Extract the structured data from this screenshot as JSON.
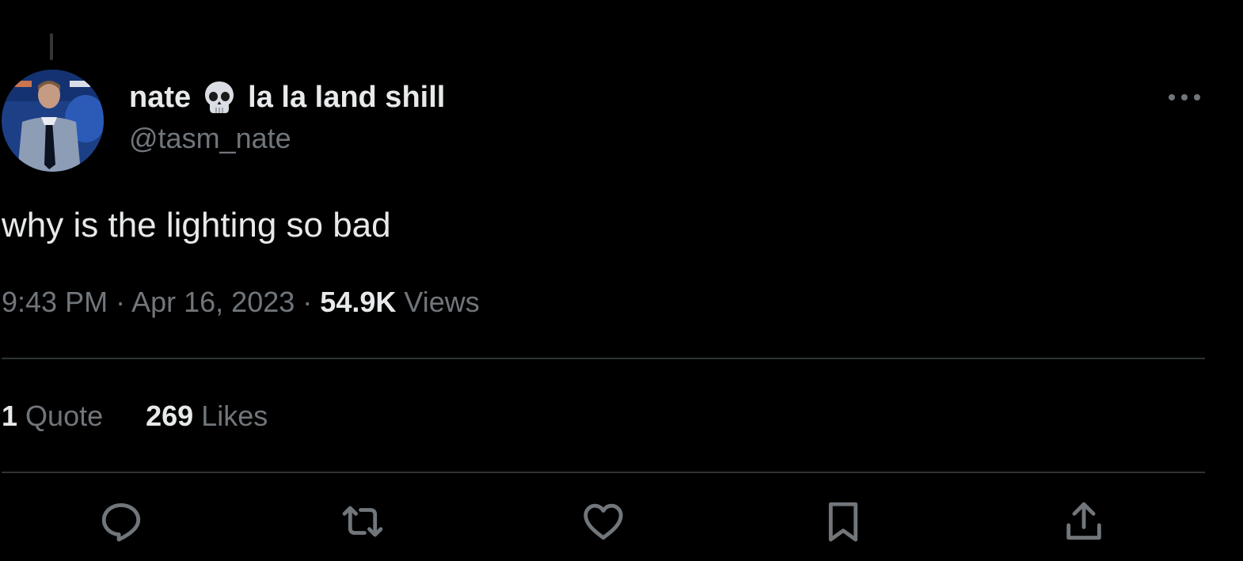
{
  "tweet": {
    "display_name_part1": "nate",
    "display_name_emoji": "skull-emoji",
    "display_name_part2": "la la land shill",
    "handle": "@tasm_nate",
    "text": "why is the lighting so bad",
    "time": "9:43 PM",
    "separator": "·",
    "date": "Apr 16, 2023",
    "views_count": "54.9K",
    "views_label": "Views",
    "quotes_count": "1",
    "quotes_label": "Quote",
    "likes_count": "269",
    "likes_label": "Likes"
  },
  "actions": [
    {
      "icon": "reply-icon"
    },
    {
      "icon": "retweet-icon"
    },
    {
      "icon": "like-heart-icon"
    },
    {
      "icon": "bookmark-icon"
    },
    {
      "icon": "share-icon"
    }
  ],
  "colors": {
    "background": "#000000",
    "primary_text": "#e7e9ea",
    "secondary_text": "#71767b",
    "divider": "#2f3336"
  }
}
